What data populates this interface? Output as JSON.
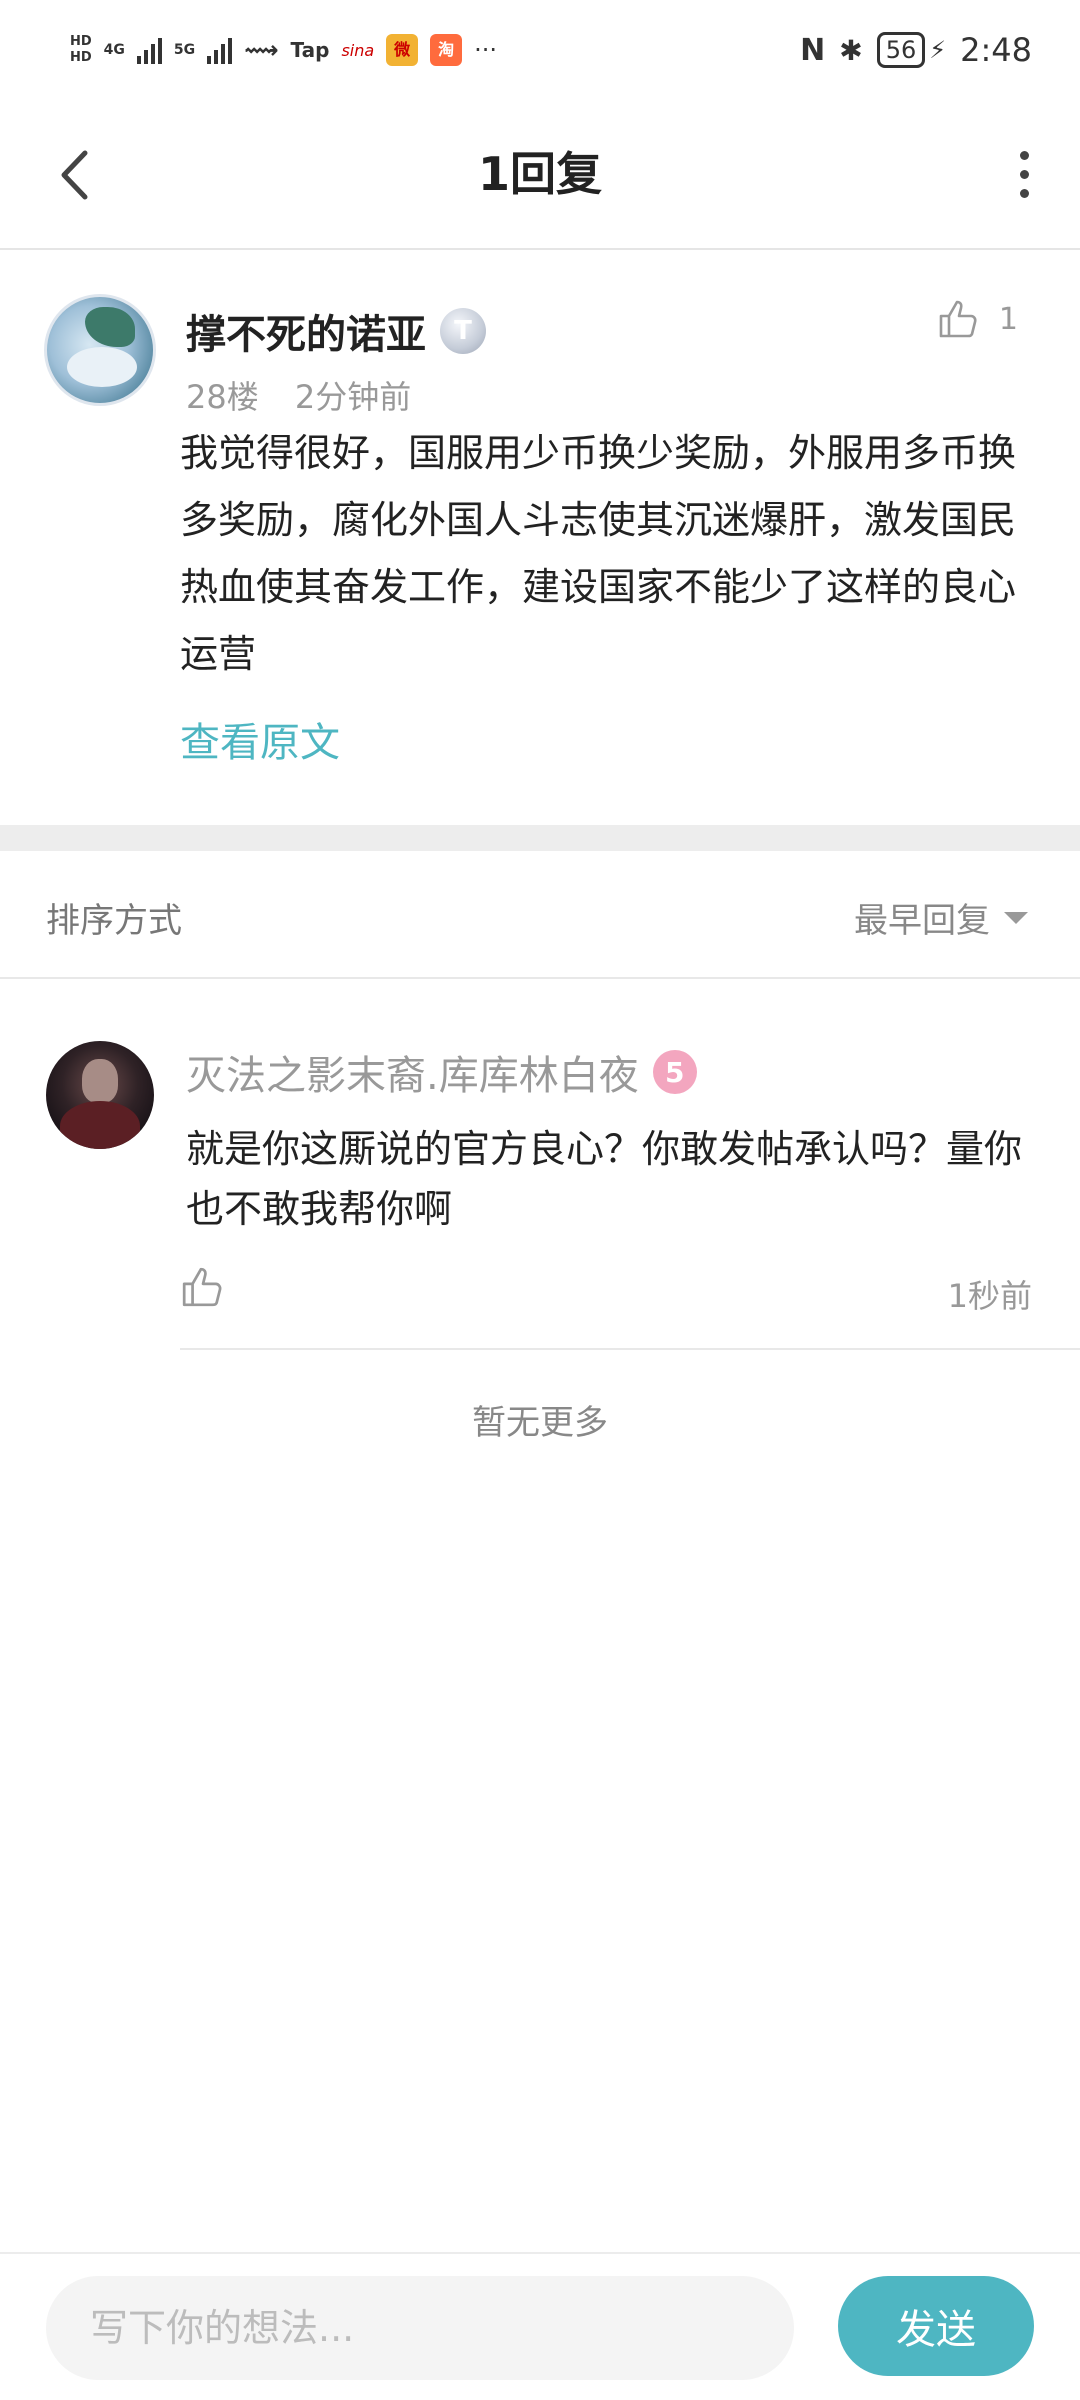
{
  "status_bar": {
    "network_1": "4G",
    "network_2": "5G",
    "hd_1": "HD",
    "hd_2": "HD",
    "app_tap": "Tap",
    "app_sina": "sina",
    "app_weibo": "微",
    "app_shop": "淘",
    "more": "···",
    "nfc": "N",
    "bluetooth": "✱",
    "battery": "56",
    "charging": "⚡",
    "time": "2:48"
  },
  "header": {
    "title": "1回复"
  },
  "post": {
    "author": "撑不死的诺亚",
    "level_badge": "T",
    "floor": "28楼",
    "time": "2分钟前",
    "likes": "1",
    "body": "我觉得很好，国服用少币换少奖励，外服用多币换多奖励，腐化外国人斗志使其沉迷爆肝，激发国民热血使其奋发工作，建设国家不能少了这样的良心运营",
    "view_original": "查看原文"
  },
  "sort": {
    "label": "排序方式",
    "selected": "最早回复"
  },
  "reply": {
    "author": "灭法之影末裔.库库林白夜",
    "level_badge": "5",
    "body": "就是你这厮说的官方良心？你敢发帖承认吗？量你也不敢我帮你啊",
    "time": "1秒前"
  },
  "footer_note": "暂无更多",
  "composer": {
    "placeholder": "写下你的想法...",
    "send_label": "发送"
  },
  "colors": {
    "accent": "#4eb6c2",
    "text_primary": "#222222",
    "text_secondary": "#999999"
  }
}
